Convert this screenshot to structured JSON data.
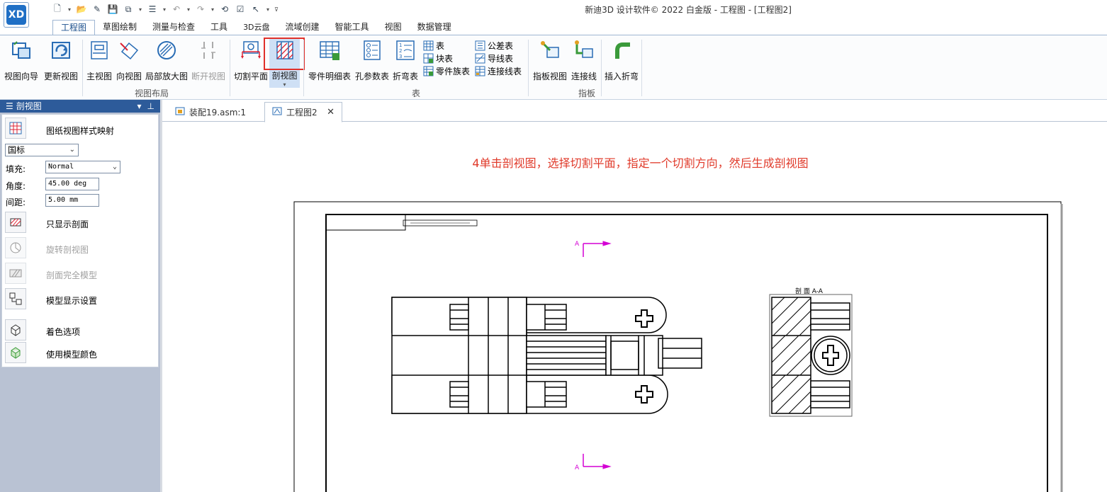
{
  "window": {
    "title": "新迪3D 设计软件© 2022 白金版 - 工程图 - [工程图2]",
    "logo_text": "XD"
  },
  "ribbon": {
    "tabs": [
      {
        "label": "工程图",
        "active": true
      },
      {
        "label": "草图绘制"
      },
      {
        "label": "测量与检查"
      },
      {
        "label": "工具"
      },
      {
        "label": "3D云盘"
      },
      {
        "label": "流域创建"
      },
      {
        "label": "智能工具"
      },
      {
        "label": "视图"
      },
      {
        "label": "数据管理"
      }
    ],
    "view_layout": {
      "group_label": "视图布局",
      "buttons": [
        "视图向导",
        "更新视图",
        "主视图",
        "向视图",
        "局部放大图",
        "断开视图",
        "切割平面",
        "剖视图"
      ]
    },
    "table_group": {
      "group_label": "表",
      "buttons": [
        "零件明细表",
        "孔参数表",
        "折弯表"
      ],
      "small": [
        "表",
        "块表",
        "零件族表",
        "公差表",
        "导线表",
        "连接线表"
      ]
    },
    "board_group": {
      "group_label": "指板",
      "buttons": [
        "指板视图",
        "连接线",
        "插入折弯"
      ]
    }
  },
  "panel": {
    "title": "剖视图",
    "style_map_label": "图纸视图样式映射",
    "standard": "国标",
    "fill_label": "填充:",
    "fill_value": "Normal",
    "angle_label": "角度:",
    "angle_value": "45.00 deg",
    "spacing_label": "间距:",
    "spacing_value": "5.00 mm",
    "options": [
      {
        "label": "只显示剖面",
        "enabled": true
      },
      {
        "label": "旋转剖视图",
        "enabled": false
      },
      {
        "label": "剖面完全模型",
        "enabled": false
      },
      {
        "label": "模型显示设置",
        "enabled": true
      },
      {
        "label": "着色选项",
        "enabled": true
      },
      {
        "label": "使用模型颜色",
        "enabled": true
      }
    ]
  },
  "doc_tabs": [
    {
      "label": "装配19.asm:1",
      "active": false
    },
    {
      "label": "工程图2",
      "active": true
    }
  ],
  "canvas": {
    "instruction": "4单击剖视图，选择切割平面，指定一个切割方向，然后生成剖视图",
    "section_label": "剖 面 A-A",
    "cut_label_top": "A",
    "cut_label_bottom": "A"
  },
  "colors": {
    "accent": "#2d5b9a",
    "instruction": "#e03a2a",
    "highlight": "#e0302a",
    "cut_line": "#d400d4"
  }
}
